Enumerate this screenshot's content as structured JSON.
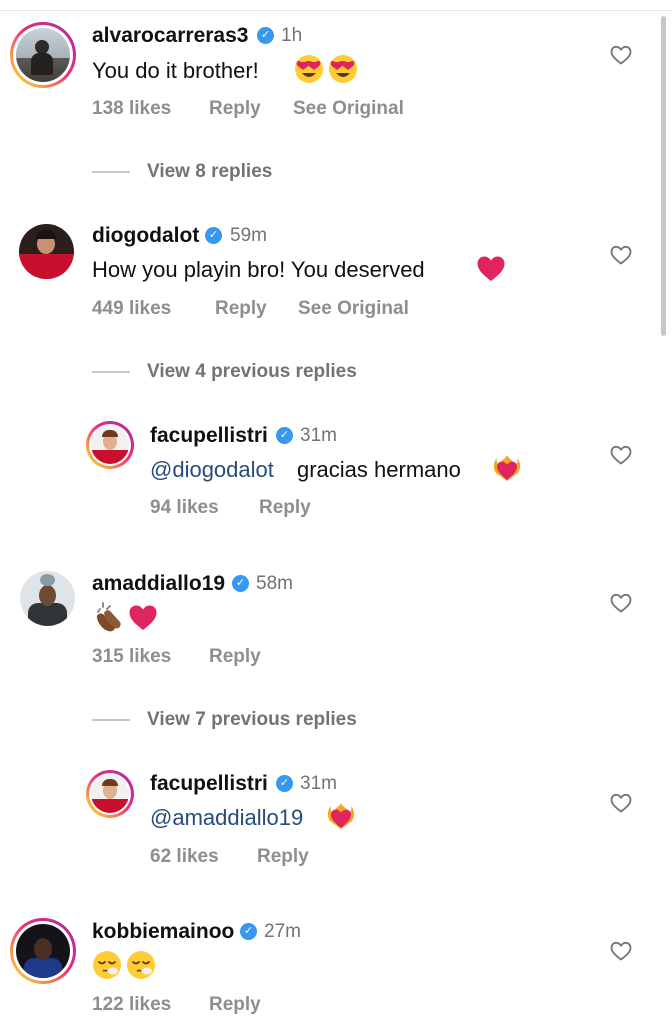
{
  "comments": [
    {
      "username": "alvarocarreras3",
      "time": "1h",
      "text": "You do it brother!",
      "likes": "138 likes",
      "reply": "Reply",
      "see_original": "See Original",
      "view_replies": "View 8 replies"
    },
    {
      "username": "diogodalot",
      "time": "59m",
      "text": "How you playin bro! You deserved",
      "likes": "449 likes",
      "reply": "Reply",
      "see_original": "See Original",
      "view_replies": "View 4 previous replies",
      "reply_item": {
        "username": "facupellistri",
        "time": "31m",
        "mention": "@diogodalot",
        "text": "gracias hermano",
        "likes": "94 likes",
        "reply": "Reply"
      }
    },
    {
      "username": "amaddiallo19",
      "time": "58m",
      "likes": "315 likes",
      "reply": "Reply",
      "view_replies": "View 7 previous replies",
      "reply_item": {
        "username": "facupellistri",
        "time": "31m",
        "mention": "@amaddiallo19",
        "likes": "62 likes",
        "reply": "Reply"
      }
    },
    {
      "username": "kobbiemainoo",
      "time": "27m",
      "likes": "122 likes",
      "reply": "Reply"
    }
  ],
  "colors": {
    "verified": "#3897f0",
    "mention": "#264b7c",
    "heart_emoji": "#e0245e"
  },
  "icons": {
    "like": "heart-outline-icon",
    "verified": "verified-badge-icon"
  }
}
